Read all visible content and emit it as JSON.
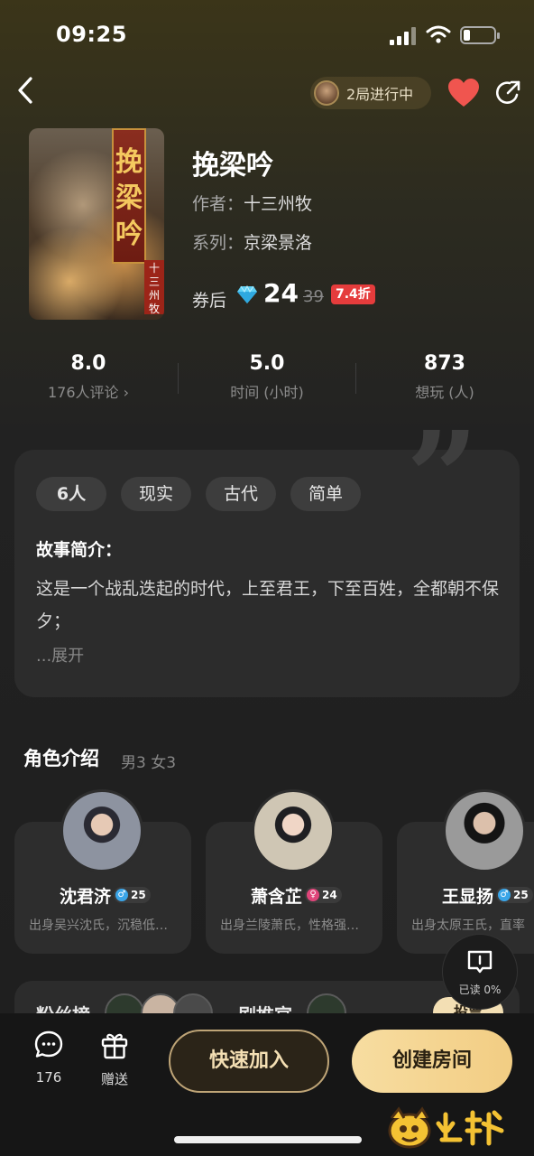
{
  "status": {
    "time": "09:25"
  },
  "nav": {
    "progress": "2局进行中"
  },
  "cover": {
    "title_chars": "挽梁吟",
    "seal_text": "十三州牧"
  },
  "book": {
    "title": "挽梁吟",
    "author_label": "作者：",
    "author": "十三州牧",
    "series_label": "系列：",
    "series": "京梁景洛",
    "price_label": "券后",
    "price": "24",
    "old_price": "39",
    "discount": "7.4折"
  },
  "stats": [
    {
      "value": "8.0",
      "label": "176人评论 ›"
    },
    {
      "value": "5.0",
      "label": "时间 (小时)"
    },
    {
      "value": "873",
      "label": "想玩 (人)"
    }
  ],
  "tags": [
    "6人",
    "现实",
    "古代",
    "简单"
  ],
  "story": {
    "heading": "故事简介：",
    "text": "这是一个战乱迭起的时代，上至君王，下至百姓，全都朝不保夕；",
    "expand": "...展开"
  },
  "roles": {
    "heading": "角色介绍",
    "summary": "男3 女3",
    "items": [
      {
        "name": "沈君济",
        "gender": "male",
        "gender_symbol": "♂",
        "age": "25",
        "desc": "出身吴兴沈氏，沉稳低…"
      },
      {
        "name": "萧含芷",
        "gender": "female",
        "gender_symbol": "♀",
        "age": "24",
        "desc": "出身兰陵萧氏，性格强…"
      },
      {
        "name": "王显扬",
        "gender": "male",
        "gender_symbol": "♂",
        "age": "25",
        "desc": "出身太原王氏，直率"
      }
    ]
  },
  "peek": {
    "left_title": "粉丝榜",
    "right_title": "剧推官",
    "badge": "投票"
  },
  "read_float": {
    "label": "已读 0%"
  },
  "bottom": {
    "comments_count": "176",
    "gift_label": "赠送",
    "join_label": "快速加入",
    "create_label": "创建房间"
  },
  "colors": {
    "accent_gold": "#f4d594",
    "discount_red": "#e53c3c",
    "heart_red": "#f0554f",
    "male_blue": "#3aa5e8",
    "female_pink": "#e0457a"
  }
}
